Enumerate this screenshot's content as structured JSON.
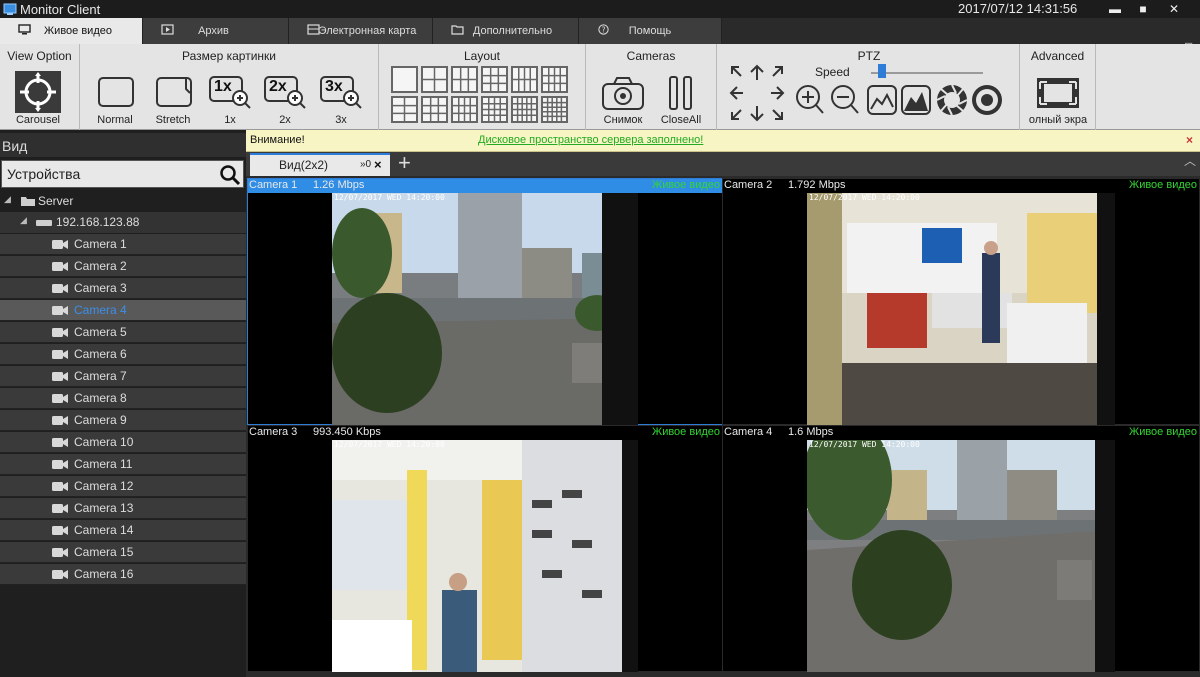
{
  "app": {
    "title": "Monitor Client",
    "datetime": "2017/07/12 14:31:56"
  },
  "window_controls": {
    "minimize": "▬",
    "maximize": "■",
    "close": "✕"
  },
  "tabs": [
    {
      "label": "Живое видео",
      "icon": "monitor-icon",
      "active": true
    },
    {
      "label": "Архив",
      "icon": "play-icon"
    },
    {
      "label": "Электронная карта",
      "icon": "map-icon"
    },
    {
      "label": "Дополнительно",
      "icon": "folder-icon"
    },
    {
      "label": "Помощь",
      "icon": "help-icon"
    }
  ],
  "ribbon": {
    "view_option": {
      "title": "View Option",
      "carousel": "Carousel"
    },
    "picture_size": {
      "title": "Размер картинки",
      "normal": "Normal",
      "stretch": "Stretch",
      "x1": "1x",
      "x2": "2x",
      "x3": "3x",
      "x1_icon": "1x",
      "x2_icon": "2x",
      "x3_icon": "3x"
    },
    "layout": {
      "title": "Layout"
    },
    "cameras": {
      "title": "Cameras",
      "snapshot": "Снимок",
      "closeall": "CloseAll"
    },
    "ptz": {
      "title": "PTZ",
      "speed": "Speed",
      "speed_level": 0.1
    },
    "advanced": {
      "title": "Advanced",
      "fullscreen": "олный экра"
    }
  },
  "sidebar": {
    "header": "Вид",
    "search_placeholder": "Устройства",
    "server": "Server",
    "ip": "192.168.123.88",
    "cameras": [
      "Camera 1",
      "Camera 2",
      "Camera 3",
      "Camera 4",
      "Camera 5",
      "Camera 6",
      "Camera 7",
      "Camera 8",
      "Camera 9",
      "Camera 10",
      "Camera 11",
      "Camera 12",
      "Camera 13",
      "Camera 14",
      "Camera 15",
      "Camera 16"
    ],
    "selected_index": 3
  },
  "notice": {
    "label": "Внимание!",
    "message": "Дисковое пространство сервера заполнено!",
    "close": "×"
  },
  "view": {
    "tab_label": "Вид(2x2)",
    "tab_suffix": "»0",
    "add": "+",
    "close": "×",
    "collapse": "︿"
  },
  "grid": [
    {
      "name": "Camera 1",
      "bitrate": "1.26 Mbps",
      "live": "Живое видео",
      "timestamp": "12/07/2017 WED 14:20:00"
    },
    {
      "name": "Camera 2",
      "bitrate": "1.792 Mbps",
      "live": "Живое видео",
      "timestamp": "12/07/2017 WED 14:20:00"
    },
    {
      "name": "Camera 3",
      "bitrate": "993.450 Kbps",
      "live": "Живое видео",
      "timestamp": "12/07/2017 WED 14:20:00"
    },
    {
      "name": "Camera 4",
      "bitrate": "1.6 Mbps",
      "live": "Живое видео",
      "timestamp": "12/07/2017 WED 14:20:00"
    }
  ],
  "colors": {
    "accent": "#2f8de6",
    "live": "#33d633",
    "ribbon": "#e4e4e4",
    "notice_bg": "#f7f5c4"
  }
}
